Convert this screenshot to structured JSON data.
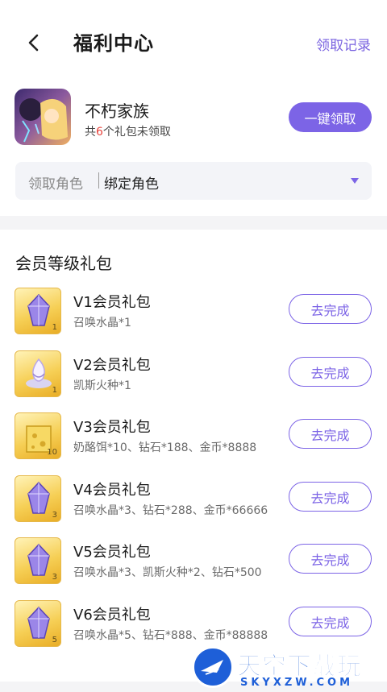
{
  "header": {
    "title": "福利中心",
    "records_link": "领取记录"
  },
  "game": {
    "name": "不朽家族",
    "summary_prefix": "共",
    "summary_count": "6",
    "summary_suffix": "个礼包未领取",
    "claim_all_label": "一键领取"
  },
  "role": {
    "label": "领取角色",
    "value": "绑定角色"
  },
  "section": {
    "title": "会员等级礼包"
  },
  "gifts": [
    {
      "name": "V1会员礼包",
      "desc": "召唤水晶*1",
      "count": "1",
      "action": "去完成",
      "icon": "purple-crystal-icon"
    },
    {
      "name": "V2会员礼包",
      "desc": "凯斯火种*1",
      "count": "1",
      "action": "去完成",
      "icon": "fire-seed-icon"
    },
    {
      "name": "V3会员礼包",
      "desc": "奶酪饵*10、钻石*188、金币*8888",
      "count": "10",
      "action": "去完成",
      "icon": "cheese-icon"
    },
    {
      "name": "V4会员礼包",
      "desc": "召唤水晶*3、钻石*288、金币*66666",
      "count": "3",
      "action": "去完成",
      "icon": "purple-crystal-icon"
    },
    {
      "name": "V5会员礼包",
      "desc": "召唤水晶*3、凯斯火种*2、钻石*500",
      "count": "3",
      "action": "去完成",
      "icon": "purple-crystal-icon"
    },
    {
      "name": "V6会员礼包",
      "desc": "召唤水晶*5、钻石*888、金币*88888",
      "count": "5",
      "action": "去完成",
      "icon": "purple-crystal-icon"
    }
  ],
  "watermark": {
    "text": "天空下载玩",
    "url": "SKYXZW.COM"
  },
  "colors": {
    "accent": "#7c64e6",
    "highlight": "#e8423b",
    "watermark": "#1e5fd8"
  }
}
